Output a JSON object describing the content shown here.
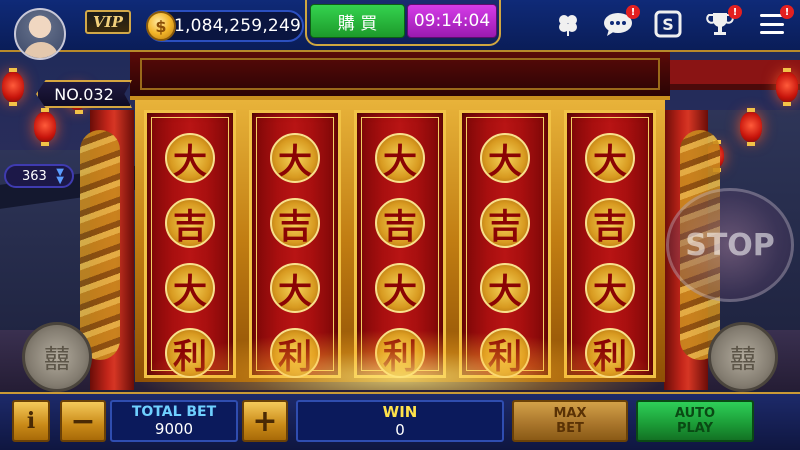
{
  "header": {
    "vip_label": "VIP",
    "coin_symbol": "$",
    "coin_balance": "1,084,259,249",
    "buy_label": "購 買",
    "timer": "09:14:04",
    "icons": [
      "clover-icon",
      "chat-icon",
      "cashier-icon",
      "trophy-icon",
      "menu-icon"
    ],
    "chat_badge": "!",
    "trophy_badge": "!",
    "menu_badge": "!"
  },
  "game": {
    "level_label": "NO.032",
    "level_count": "363",
    "stop_label": "STOP",
    "reels": [
      [
        "大",
        "吉",
        "大",
        "利"
      ],
      [
        "大",
        "吉",
        "大",
        "利"
      ],
      [
        "大",
        "吉",
        "大",
        "利"
      ],
      [
        "大",
        "吉",
        "大",
        "利"
      ],
      [
        "大",
        "吉",
        "大",
        "利"
      ]
    ]
  },
  "footer": {
    "info_label": "i",
    "minus_label": "−",
    "plus_label": "+",
    "total_bet_label": "TOTAL BET",
    "total_bet_value": "9000",
    "win_label": "WIN",
    "win_value": "0",
    "max_bet_line1": "MAX",
    "max_bet_line2": "BET",
    "auto_play_line1": "AUTO",
    "auto_play_line2": "PLAY"
  },
  "colors": {
    "accent_gold": "#d6a640",
    "reel_red": "#b81414",
    "buy_green": "#1d9a2a",
    "timer_purple": "#9a1ab0"
  }
}
